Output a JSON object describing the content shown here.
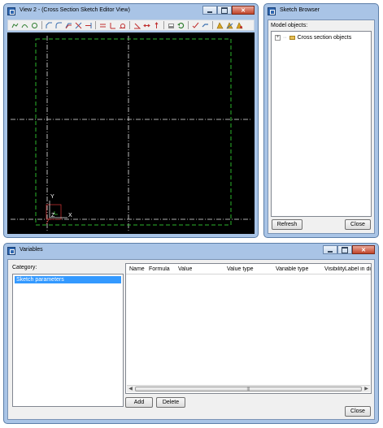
{
  "view_window": {
    "title": "View 2 - (Cross Section Sketch Editor View)",
    "axis_labels": {
      "y": "Y",
      "x": "X",
      "z": "Z"
    }
  },
  "sketch_browser": {
    "title": "Sketch Browser",
    "model_objects_label": "Model objects:",
    "tree_item": "Cross section objects",
    "refresh_label": "Refresh",
    "close_label": "Close"
  },
  "variables": {
    "title": "Variables",
    "category_label": "Category:",
    "categories": [
      "Sketch parameters"
    ],
    "columns": [
      "Name",
      "Formula",
      "Value",
      "Value type",
      "Variable type",
      "Visibility",
      "Label in dialo"
    ],
    "add_label": "Add",
    "delete_label": "Delete",
    "close_label": "Close"
  },
  "colors": {
    "frame": "#a9c4e6",
    "canvas": "#000000",
    "sketch_outline": "#2db52d",
    "construction_line": "#e8e8e8",
    "selection": "#3399ff"
  }
}
